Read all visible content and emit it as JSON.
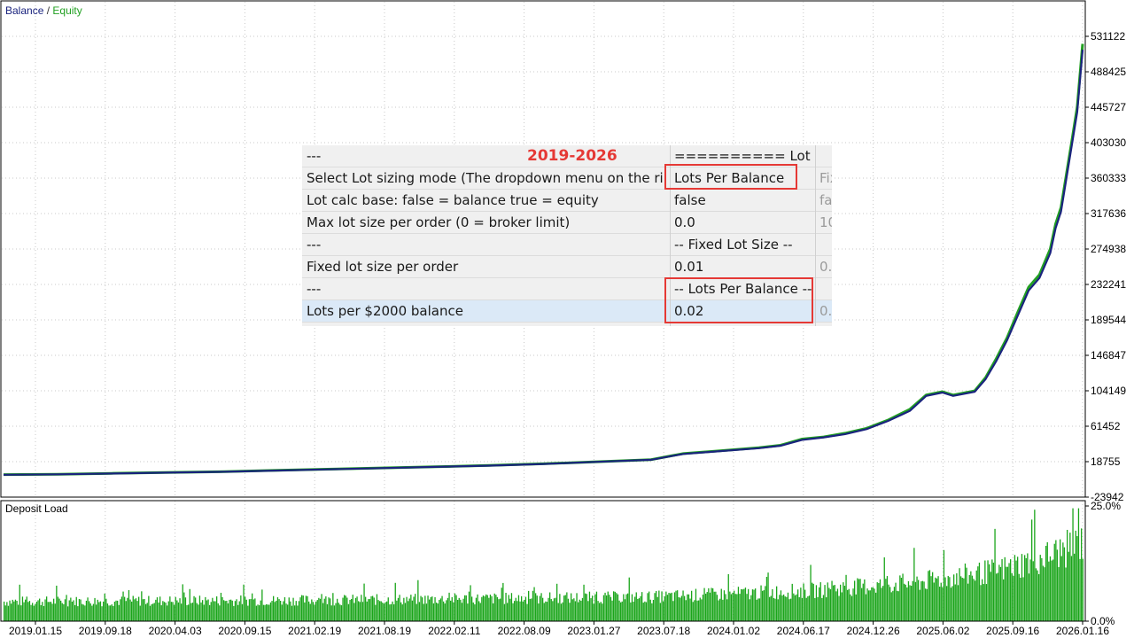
{
  "colors": {
    "balance": "#1a237e",
    "equity": "#22a022",
    "deposit_bars": "#1aa51a",
    "axis": "#000000",
    "grid": "#c8c8c8",
    "highlight": "#e53935"
  },
  "chart_data": [
    {
      "type": "line",
      "legend": [
        "Balance",
        "Equity"
      ],
      "legend_separator": "/",
      "grid": true,
      "y_ticks": [
        "531122",
        "488425",
        "445727",
        "403030",
        "360333",
        "317636",
        "274938",
        "232241",
        "189544",
        "146847",
        "104149",
        "61452",
        "18755",
        "-23942"
      ],
      "ylim": [
        -23942,
        531122
      ],
      "series": [
        {
          "name": "Balance",
          "x": [
            0,
            0.05,
            0.1,
            0.15,
            0.2,
            0.25,
            0.3,
            0.35,
            0.4,
            0.45,
            0.5,
            0.55,
            0.6,
            0.63,
            0.66,
            0.7,
            0.72,
            0.74,
            0.76,
            0.78,
            0.8,
            0.82,
            0.84,
            0.855,
            0.87,
            0.88,
            0.9,
            0.91,
            0.92,
            0.93,
            0.94,
            0.95,
            0.96,
            0.97,
            0.975,
            0.98,
            0.985,
            0.99,
            0.995,
            1.0
          ],
          "values": [
            3000,
            3500,
            4500,
            5500,
            6500,
            8000,
            9500,
            11000,
            12500,
            14000,
            16000,
            18500,
            21000,
            28000,
            31000,
            35000,
            38000,
            45000,
            48000,
            52000,
            58000,
            68000,
            80000,
            98000,
            102000,
            98000,
            103000,
            118000,
            140000,
            165000,
            195000,
            225000,
            240000,
            270000,
            300000,
            320000,
            360000,
            400000,
            440000,
            515000
          ]
        },
        {
          "name": "Equity",
          "x": [
            0,
            0.05,
            0.1,
            0.15,
            0.2,
            0.25,
            0.3,
            0.35,
            0.4,
            0.45,
            0.5,
            0.55,
            0.6,
            0.63,
            0.66,
            0.7,
            0.72,
            0.74,
            0.76,
            0.78,
            0.8,
            0.82,
            0.84,
            0.855,
            0.87,
            0.88,
            0.9,
            0.91,
            0.92,
            0.93,
            0.94,
            0.95,
            0.96,
            0.97,
            0.975,
            0.98,
            0.985,
            0.99,
            0.995,
            1.0
          ],
          "values": [
            3200,
            3600,
            4700,
            5600,
            6600,
            8200,
            9700,
            11200,
            12600,
            14200,
            16200,
            18700,
            21200,
            28500,
            31500,
            35500,
            38500,
            46000,
            48500,
            53000,
            59000,
            69000,
            82000,
            99000,
            103000,
            99000,
            104000,
            120000,
            143000,
            168000,
            199000,
            229000,
            244000,
            275000,
            305000,
            325000,
            365000,
            405000,
            446000,
            522000
          ]
        }
      ]
    },
    {
      "type": "bar",
      "title": "Deposit Load",
      "y_ticks": [
        "25.0%",
        "0.0%"
      ],
      "ylim": [
        0,
        25
      ],
      "x_ticks": [
        "2019.01.15",
        "2019.09.18",
        "2020.04.03",
        "2020.09.15",
        "2021.02.19",
        "2021.08.19",
        "2022.02.11",
        "2022.08.09",
        "2023.01.27",
        "2023.07.18",
        "2024.01.02",
        "2024.06.17",
        "2024.12.26",
        "2025.06.02",
        "2025.09.16",
        "2026.01.16"
      ],
      "segments_x": [
        0,
        0.3,
        0.6,
        0.75,
        0.85,
        0.92,
        0.97,
        1.0
      ],
      "segments_pct": [
        4.5,
        4.8,
        5.5,
        7,
        9,
        11.5,
        15,
        18
      ]
    }
  ],
  "overlay": {
    "period_label": "2019-2026",
    "rows": [
      {
        "c0": "---",
        "c1": "========== Lot Size =",
        "c2": ""
      },
      {
        "c0": "Select Lot sizing mode (The dropdown menu on the ri...",
        "c1": "Lots Per Balance",
        "c2": "Fix"
      },
      {
        "c0": "Lot calc base: false = balance  true = equity",
        "c1": "false",
        "c2": "fa"
      },
      {
        "c0": "Max lot size per order (0 = broker limit)",
        "c1": "0.0",
        "c2": "10"
      },
      {
        "c0": "---",
        "c1": "-- Fixed Lot Size --",
        "c2": ""
      },
      {
        "c0": "Fixed lot size per order",
        "c1": "0.01",
        "c2": "0."
      },
      {
        "c0": "---",
        "c1": "-- Lots Per Balance --",
        "c2": ""
      },
      {
        "c0": "Lots per $2000 balance",
        "c1": "0.02",
        "c2": "0."
      }
    ]
  }
}
